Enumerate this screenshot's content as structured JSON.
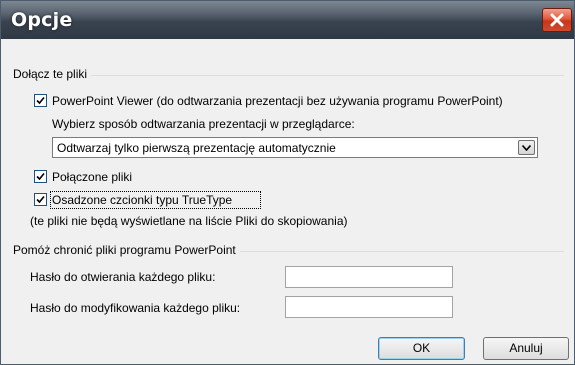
{
  "window": {
    "title": "Opcje"
  },
  "include_files": {
    "group_label": "Dołącz te pliki",
    "viewer_checkbox": {
      "label": "PowerPoint Viewer (do odtwarzania prezentacji bez używania programu PowerPoint)",
      "checked": true
    },
    "playback_label": "Wybierz sposób odtwarzania prezentacji w przeglądarce:",
    "playback_select": {
      "value": "Odtwarzaj tylko pierwszą prezentację automatycznie"
    },
    "linked_files_checkbox": {
      "label": "Połączone pliki",
      "checked": true
    },
    "fonts_checkbox": {
      "label": "Osadzone czcionki typu TrueType",
      "checked": true
    },
    "note": "(te pliki nie będą wyświetlane na liście Pliki do skopiowania)"
  },
  "protect": {
    "group_label": "Pomóż chronić pliki programu PowerPoint",
    "open_password_label": "Hasło do otwierania każdego pliku:",
    "open_password_value": "",
    "modify_password_label": "Hasło do modyfikowania każdego pliku:",
    "modify_password_value": ""
  },
  "buttons": {
    "ok": "OK",
    "cancel": "Anuluj"
  },
  "colors": {
    "title_bar": "#3a4450",
    "close_button": "#d9452a",
    "dialog_bg": "#f0f0f0"
  }
}
